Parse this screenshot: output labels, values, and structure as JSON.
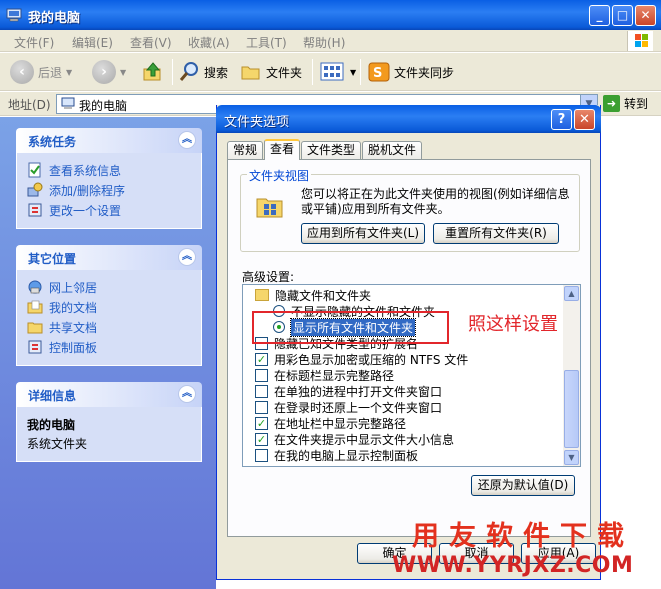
{
  "window": {
    "title": "我的电脑"
  },
  "menu": [
    "文件(F)",
    "编辑(E)",
    "查看(V)",
    "收藏(A)",
    "工具(T)",
    "帮助(H)"
  ],
  "toolbar": {
    "back": "后退",
    "search": "搜索",
    "folders": "文件夹",
    "sync": "文件夹同步"
  },
  "address": {
    "label": "地址(D)",
    "value": "我的电脑",
    "go": "转到"
  },
  "task_pane": {
    "system": {
      "title": "系统任务",
      "items": [
        "查看系统信息",
        "添加/删除程序",
        "更改一个设置"
      ]
    },
    "places": {
      "title": "其它位置",
      "items": [
        "网上邻居",
        "我的文档",
        "共享文档",
        "控制面板"
      ]
    },
    "details": {
      "title": "详细信息",
      "name": "我的电脑",
      "desc": "系统文件夹"
    }
  },
  "dialog": {
    "title": "文件夹选项",
    "tabs": [
      "常规",
      "查看",
      "文件类型",
      "脱机文件"
    ],
    "active_tab": "查看",
    "folder_views": {
      "label": "文件夹视图",
      "desc": "您可以将正在为此文件夹使用的视图(例如详细信息或平铺)应用到所有文件夹。",
      "apply_btn": "应用到所有文件夹(L)",
      "reset_btn": "重置所有文件夹(R)"
    },
    "advanced_label": "高级设置:",
    "settings": {
      "r0": "隐藏文件和文件夹",
      "r1": "不显示隐藏的文件和文件夹",
      "r2": "显示所有文件和文件夹",
      "r3": "隐藏已知文件类型的扩展名",
      "r4": "用彩色显示加密或压缩的 NTFS 文件",
      "r5": "在标题栏显示完整路径",
      "r6": "在单独的进程中打开文件夹窗口",
      "r7": "在登录时还原上一个文件夹窗口",
      "r8": "在地址栏中显示完整路径",
      "r9": "在文件夹提示中显示文件大小信息",
      "r10": "在我的电脑上显示控制面板"
    },
    "restore_btn": "还原为默认值(D)",
    "ok": "确定",
    "cancel": "取消",
    "apply": "应用(A)"
  },
  "annotation": "照这样设置",
  "watermark": {
    "cn": "用友软件下载",
    "url": "WWW.YYRJXZ.COM"
  }
}
